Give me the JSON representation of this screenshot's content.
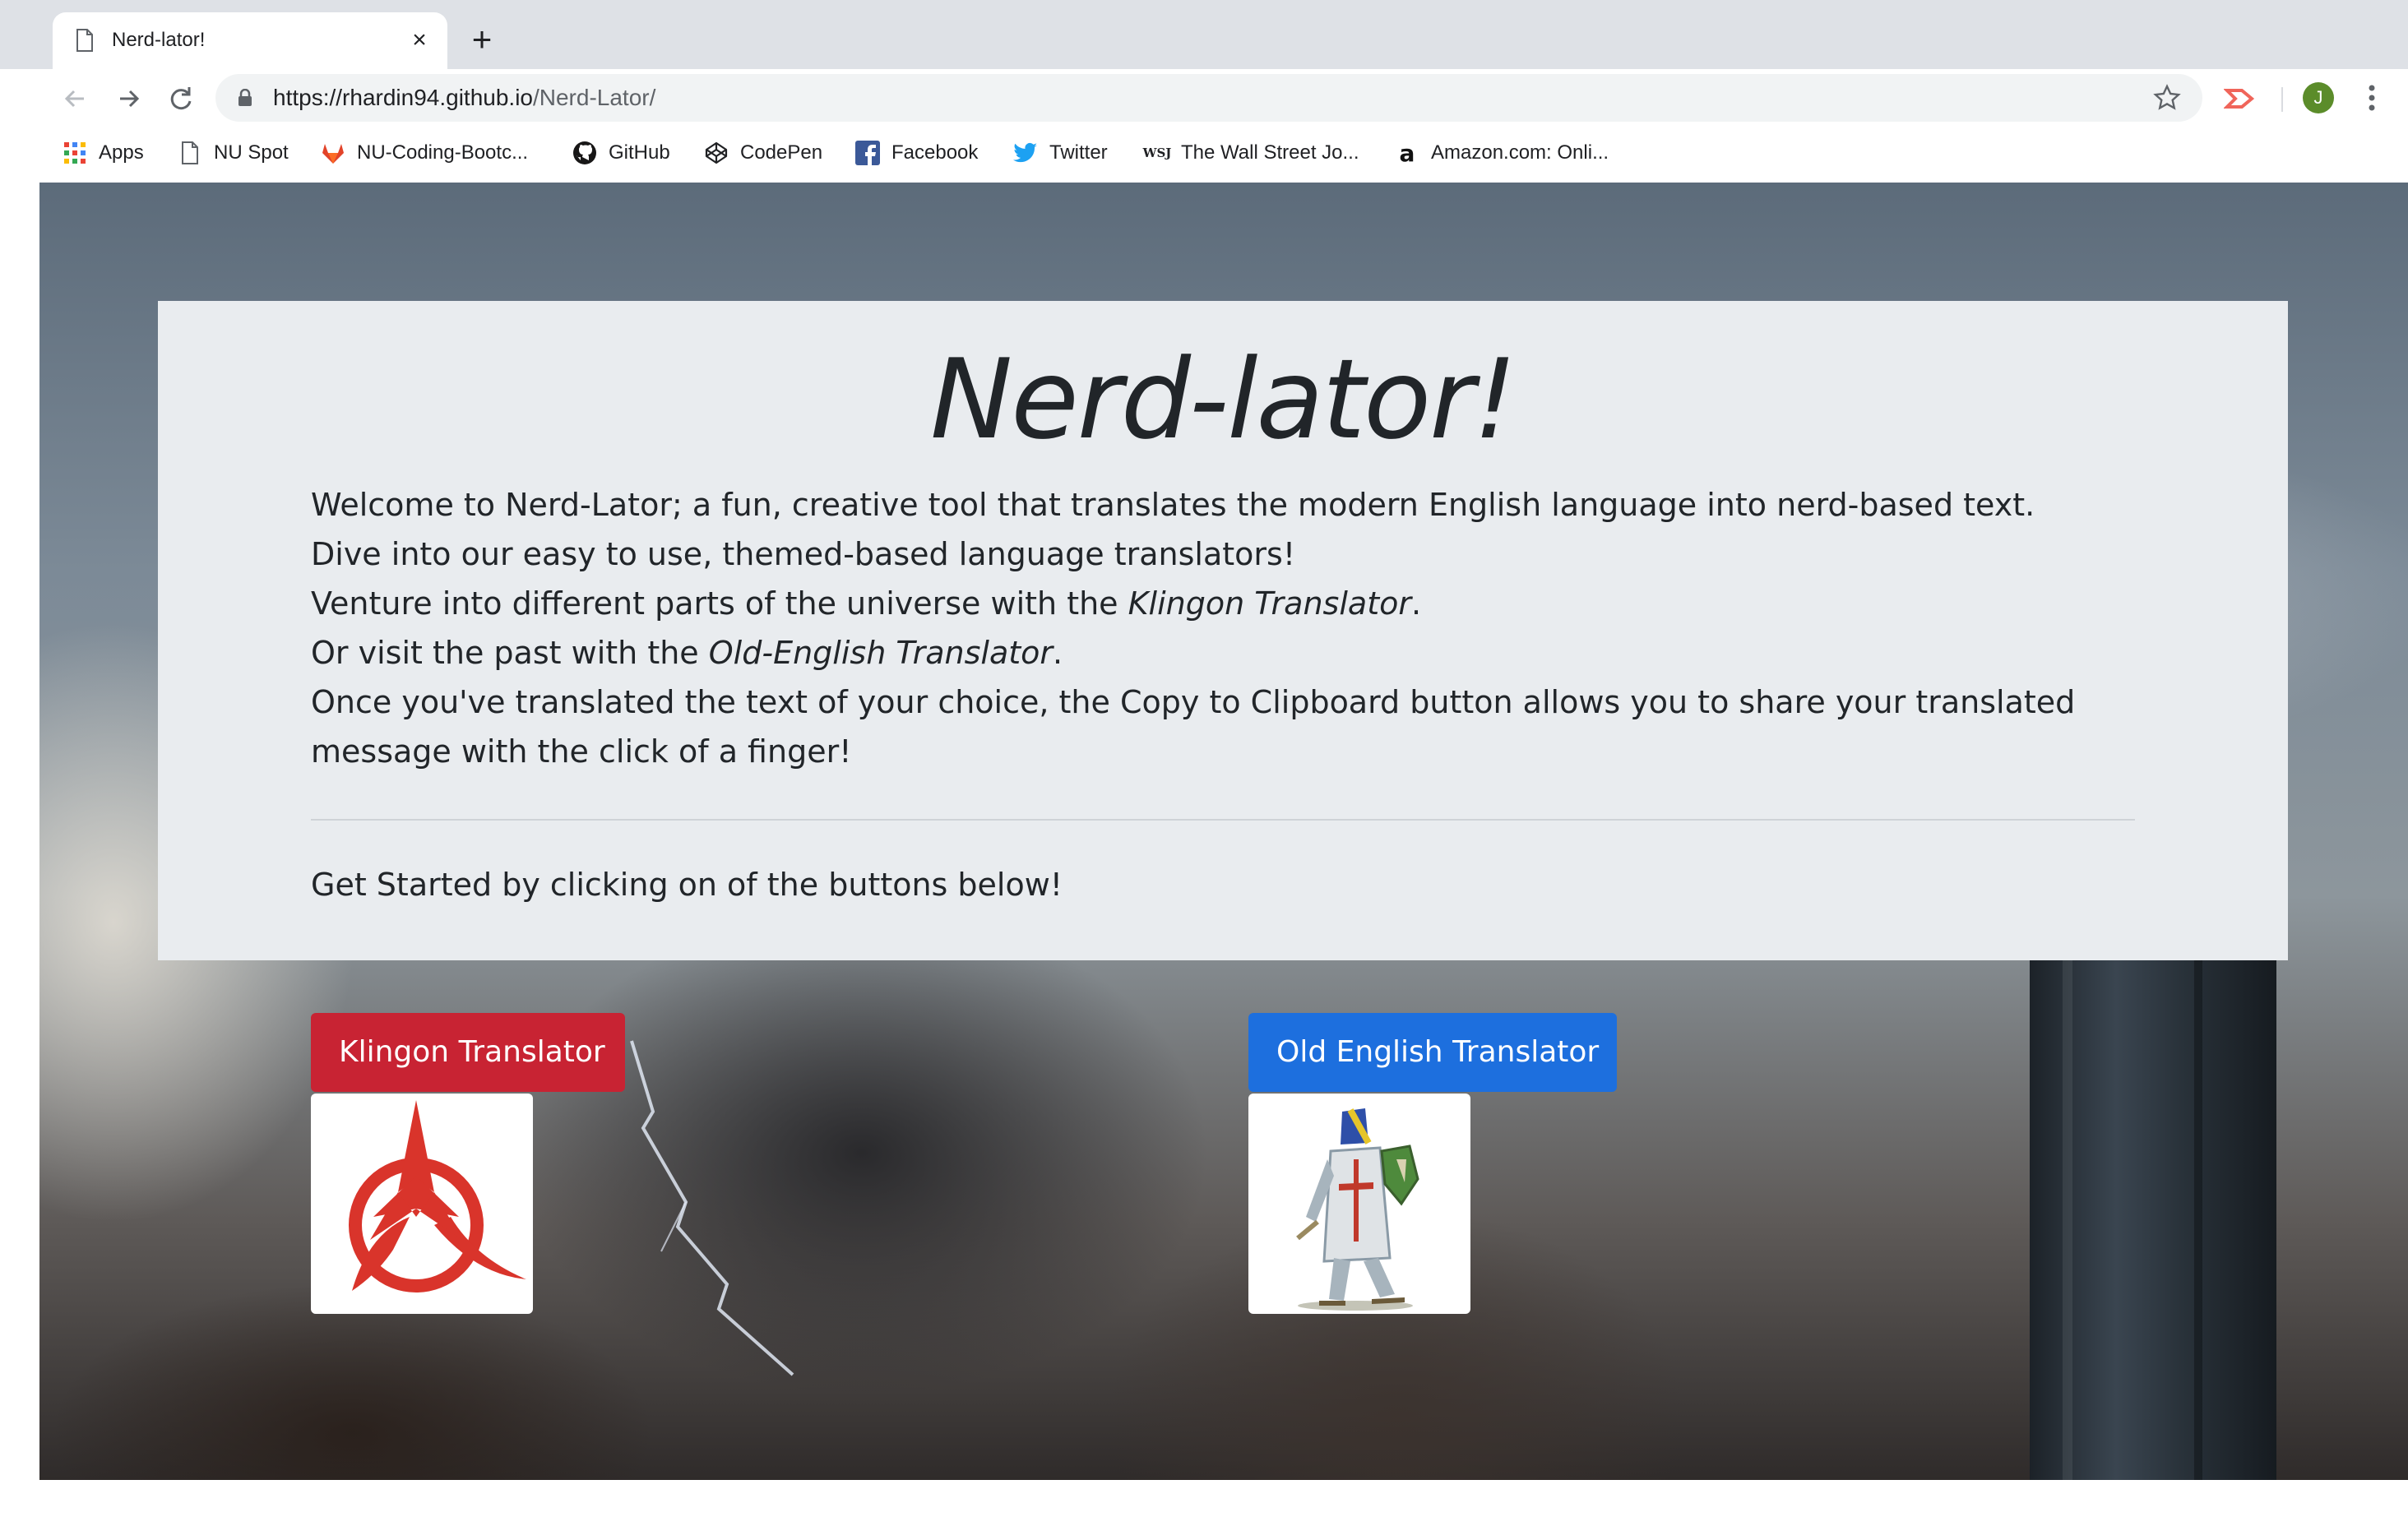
{
  "browser": {
    "tab_title": "Nerd-lator!",
    "tab_close": "×",
    "new_tab": "+",
    "url_host": "https://rhardin94.github.io",
    "url_path": "/Nerd-Lator/",
    "avatar_initial": "J",
    "bookmarks": [
      {
        "label": "Apps",
        "icon": "apps-grid-icon"
      },
      {
        "label": "NU Spot",
        "icon": "page-icon"
      },
      {
        "label": "NU-Coding-Bootc...",
        "icon": "gitlab-icon"
      },
      {
        "label": "GitHub",
        "icon": "github-icon"
      },
      {
        "label": "CodePen",
        "icon": "codepen-icon"
      },
      {
        "label": "Facebook",
        "icon": "facebook-icon"
      },
      {
        "label": "Twitter",
        "icon": "twitter-icon"
      },
      {
        "label": "The Wall Street Jo...",
        "icon": "wsj-icon"
      },
      {
        "label": "Amazon.com: Onli...",
        "icon": "amazon-icon"
      }
    ]
  },
  "page": {
    "title": "Nerd-lator!",
    "intro": {
      "line1": "Welcome to Nerd-Lator; a fun, creative tool that translates the modern English language into nerd-based text.",
      "line2": "Dive into our easy to use, themed-based language translators!",
      "line3_prefix": "Venture into different parts of the universe with the ",
      "line3_em": "Klingon Translator",
      "line3_suffix": ".",
      "line4_prefix": "Or visit the past with the ",
      "line4_em": "Old-English Translator",
      "line4_suffix": ".",
      "line5": "Once you've translated the text of your choice, the Copy to Clipboard button allows you to share your translated message with the click of a finger!"
    },
    "cta": "Get Started by clicking on of the buttons below!",
    "buttons": {
      "klingon": "Klingon Translator",
      "old_english": "Old English Translator"
    }
  },
  "colors": {
    "klingon_button": "#c82333",
    "old_english_button": "#1d6fde",
    "jumbotron": "#e9ecef",
    "klingon_emblem": "#d9342b"
  }
}
